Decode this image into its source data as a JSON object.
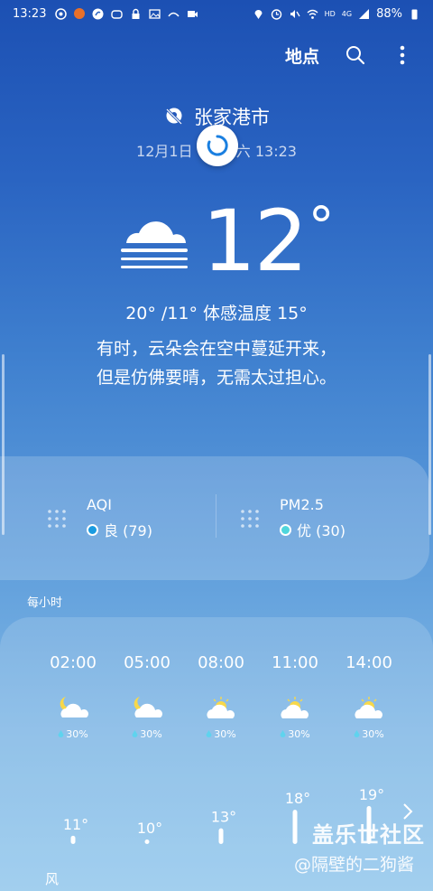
{
  "status_bar": {
    "time": "13:23",
    "battery": "88%",
    "network": "4G",
    "hd": "HD"
  },
  "header": {
    "location_label": "地点"
  },
  "location": {
    "city": "张家港市",
    "date_left": "12月1日",
    "date_right": "六 13:23"
  },
  "current": {
    "temp": "12",
    "deg": "°",
    "range": "20° /11°  体感温度 15°",
    "desc_line1": "有时，云朵会在空中蔓延开来，",
    "desc_line2": "但是仿佛要晴，无需太过担心。"
  },
  "air_quality": [
    {
      "name": "AQI",
      "level": "良 (79)",
      "color": "#1a9be0"
    },
    {
      "name": "PM2.5",
      "level": "优 (30)",
      "color": "#4fd6dc"
    }
  ],
  "hourly_label": "每小时",
  "hourly": [
    {
      "time": "02:00",
      "icon": "moon-cloud-icon",
      "rain": "30%",
      "temp": "11°",
      "value": 11
    },
    {
      "time": "05:00",
      "icon": "moon-cloud-icon",
      "rain": "30%",
      "temp": "10°",
      "value": 10
    },
    {
      "time": "08:00",
      "icon": "sun-cloud-icon",
      "rain": "30%",
      "temp": "13°",
      "value": 13
    },
    {
      "time": "11:00",
      "icon": "sun-cloud-icon",
      "rain": "30%",
      "temp": "18°",
      "value": 18
    },
    {
      "time": "14:00",
      "icon": "sun-cloud-icon",
      "rain": "30%",
      "temp": "19°",
      "value": 19
    }
  ],
  "wind_label": "风",
  "watermark": {
    "line1": "盖乐世社区",
    "line2": "@隔壁的二狗酱"
  }
}
